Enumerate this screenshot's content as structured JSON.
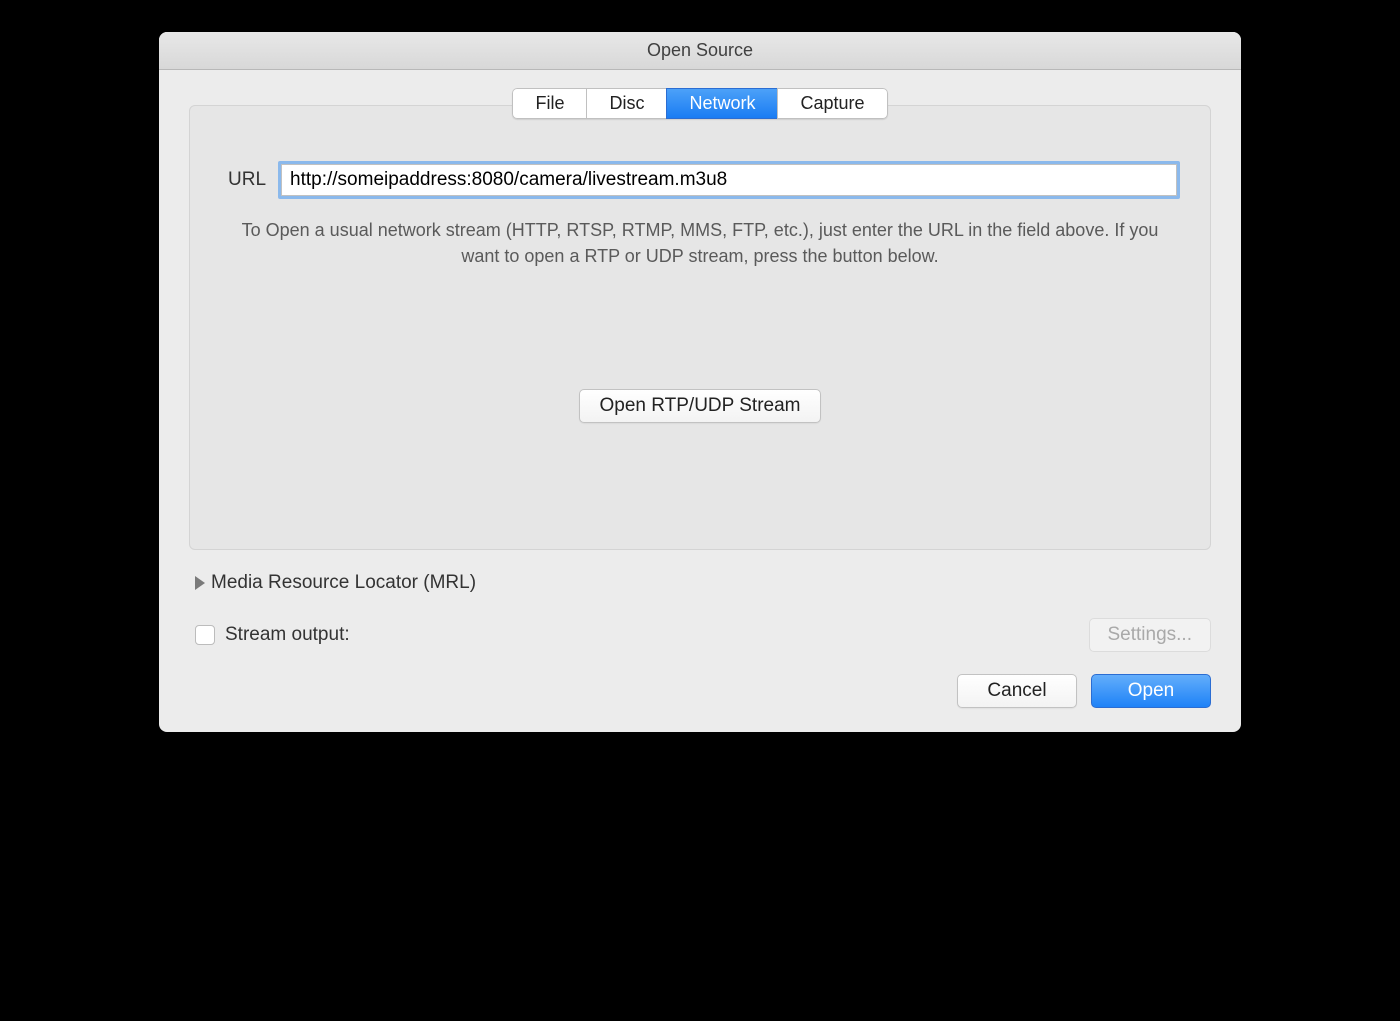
{
  "window": {
    "title": "Open Source"
  },
  "tabs": {
    "file": "File",
    "disc": "Disc",
    "network": "Network",
    "capture": "Capture"
  },
  "network": {
    "url_label": "URL",
    "url_value": "http://someipaddress:8080/camera/livestream.m3u8",
    "help_text": "To Open a usual network stream (HTTP, RTSP, RTMP, MMS, FTP, etc.), just enter the URL in the field above. If you want to open a RTP or UDP stream, press the button below.",
    "rtp_button": "Open RTP/UDP Stream"
  },
  "disclosure": {
    "mrl_label": "Media Resource Locator (MRL)"
  },
  "stream": {
    "label": "Stream output:",
    "settings_label": "Settings..."
  },
  "footer": {
    "cancel": "Cancel",
    "open": "Open"
  }
}
